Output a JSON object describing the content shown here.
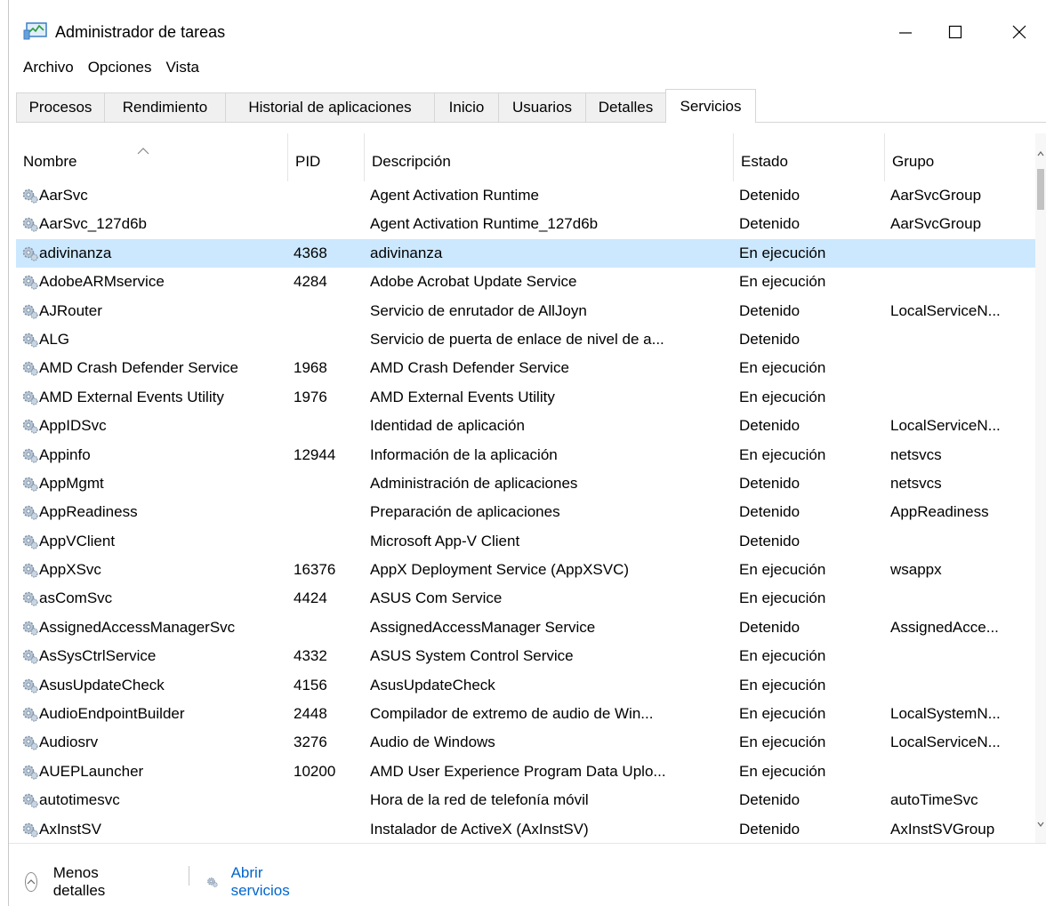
{
  "window": {
    "title": "Administrador de tareas",
    "icon": "task-manager-icon",
    "controls": [
      "minimize-icon",
      "maximize-icon",
      "close-icon"
    ]
  },
  "menu": [
    "Archivo",
    "Opciones",
    "Vista"
  ],
  "tabs": [
    {
      "label": "Procesos",
      "active": false
    },
    {
      "label": "Rendimiento",
      "active": false
    },
    {
      "label": "Historial de aplicaciones",
      "active": false
    },
    {
      "label": "Inicio",
      "active": false
    },
    {
      "label": "Usuarios",
      "active": false
    },
    {
      "label": "Detalles",
      "active": false
    },
    {
      "label": "Servicios",
      "active": true
    }
  ],
  "columns": [
    "Nombre",
    "PID",
    "Descripción",
    "Estado",
    "Grupo"
  ],
  "sort": {
    "column": "Nombre",
    "direction": "ascending"
  },
  "selected_row": "adivinanza",
  "rows": [
    {
      "name": "AarSvc",
      "pid": "",
      "description": "Agent Activation Runtime",
      "state": "Detenido",
      "group": "AarSvcGroup"
    },
    {
      "name": "AarSvc_127d6b",
      "pid": "",
      "description": "Agent Activation Runtime_127d6b",
      "state": "Detenido",
      "group": "AarSvcGroup"
    },
    {
      "name": "adivinanza",
      "pid": "4368",
      "description": "adivinanza",
      "state": "En ejecución",
      "group": ""
    },
    {
      "name": "AdobeARMservice",
      "pid": "4284",
      "description": "Adobe Acrobat Update Service",
      "state": "En ejecución",
      "group": ""
    },
    {
      "name": "AJRouter",
      "pid": "",
      "description": "Servicio de enrutador de AllJoyn",
      "state": "Detenido",
      "group": "LocalServiceN..."
    },
    {
      "name": "ALG",
      "pid": "",
      "description": "Servicio de puerta de enlace de nivel de a...",
      "state": "Detenido",
      "group": ""
    },
    {
      "name": "AMD Crash Defender Service",
      "pid": "1968",
      "description": "AMD Crash Defender Service",
      "state": "En ejecución",
      "group": ""
    },
    {
      "name": "AMD External Events Utility",
      "pid": "1976",
      "description": "AMD External Events Utility",
      "state": "En ejecución",
      "group": ""
    },
    {
      "name": "AppIDSvc",
      "pid": "",
      "description": "Identidad de aplicación",
      "state": "Detenido",
      "group": "LocalServiceN..."
    },
    {
      "name": "Appinfo",
      "pid": "12944",
      "description": "Información de la aplicación",
      "state": "En ejecución",
      "group": "netsvcs"
    },
    {
      "name": "AppMgmt",
      "pid": "",
      "description": "Administración de aplicaciones",
      "state": "Detenido",
      "group": "netsvcs"
    },
    {
      "name": "AppReadiness",
      "pid": "",
      "description": "Preparación de aplicaciones",
      "state": "Detenido",
      "group": "AppReadiness"
    },
    {
      "name": "AppVClient",
      "pid": "",
      "description": "Microsoft App-V Client",
      "state": "Detenido",
      "group": ""
    },
    {
      "name": "AppXSvc",
      "pid": "16376",
      "description": "AppX Deployment Service (AppXSVC)",
      "state": "En ejecución",
      "group": "wsappx"
    },
    {
      "name": "asComSvc",
      "pid": "4424",
      "description": "ASUS Com Service",
      "state": "En ejecución",
      "group": ""
    },
    {
      "name": "AssignedAccessManagerSvc",
      "pid": "",
      "description": "AssignedAccessManager Service",
      "state": "Detenido",
      "group": "AssignedAcce..."
    },
    {
      "name": "AsSysCtrlService",
      "pid": "4332",
      "description": "ASUS System Control Service",
      "state": "En ejecución",
      "group": ""
    },
    {
      "name": "AsusUpdateCheck",
      "pid": "4156",
      "description": "AsusUpdateCheck",
      "state": "En ejecución",
      "group": ""
    },
    {
      "name": "AudioEndpointBuilder",
      "pid": "2448",
      "description": "Compilador de extremo de audio de Win...",
      "state": "En ejecución",
      "group": "LocalSystemN..."
    },
    {
      "name": "Audiosrv",
      "pid": "3276",
      "description": "Audio de Windows",
      "state": "En ejecución",
      "group": "LocalServiceN..."
    },
    {
      "name": "AUEPLauncher",
      "pid": "10200",
      "description": "AMD User Experience Program Data Uplo...",
      "state": "En ejecución",
      "group": ""
    },
    {
      "name": "autotimesvc",
      "pid": "",
      "description": "Hora de la red de telefonía móvil",
      "state": "Detenido",
      "group": "autoTimeSvc"
    },
    {
      "name": "AxInstSV",
      "pid": "",
      "description": "Instalador de ActiveX (AxInstSV)",
      "state": "Detenido",
      "group": "AxInstSVGroup"
    }
  ],
  "footer": {
    "less_details": "Menos detalles",
    "open_services": "Abrir servicios"
  },
  "colors": {
    "selection": "#cce8ff",
    "link": "#0066cc",
    "tab_inactive": "#f0f0f0"
  }
}
